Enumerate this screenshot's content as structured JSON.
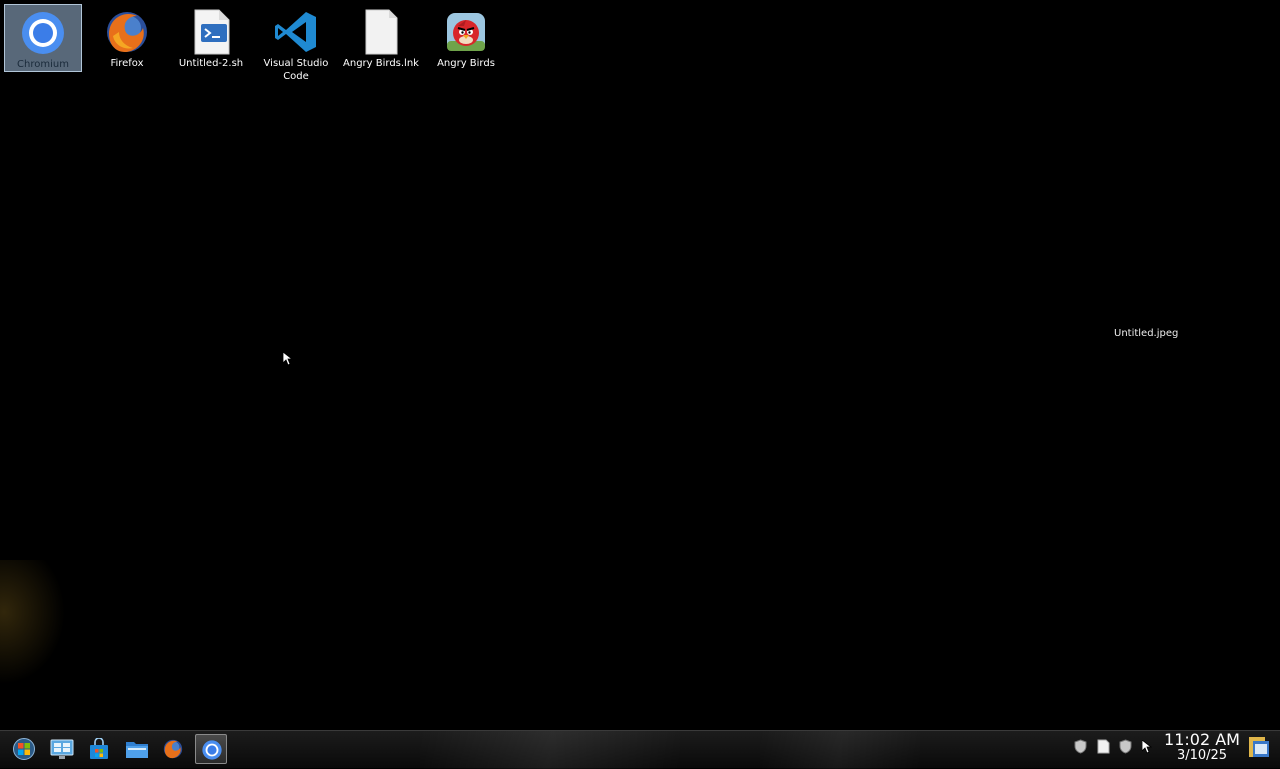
{
  "desktop": {
    "icons": [
      {
        "label": "Chromium",
        "icon": "chromium-icon"
      },
      {
        "label": "Firefox",
        "icon": "firefox-icon"
      },
      {
        "label": "Untitled-2.sh",
        "icon": "script-file-icon"
      },
      {
        "label": "Visual Studio Code",
        "icon": "vscode-icon"
      },
      {
        "label": "Angry Birds.lnk",
        "icon": "blank-file-icon"
      },
      {
        "label": "Angry Birds",
        "icon": "angry-birds-icon"
      }
    ],
    "floating_label": "Untitled.jpeg"
  },
  "taskbar": {
    "buttons": [
      {
        "name": "start-button",
        "icon": "start-orb-icon"
      },
      {
        "name": "control-panel-button",
        "icon": "control-panel-icon"
      },
      {
        "name": "store-button",
        "icon": "store-bag-icon"
      },
      {
        "name": "file-explorer-button",
        "icon": "folder-icon"
      },
      {
        "name": "firefox-taskbar-button",
        "icon": "firefox-icon"
      },
      {
        "name": "chromium-taskbar-button",
        "icon": "chromium-icon",
        "active": true
      }
    ],
    "clock": {
      "time": "11:02 AM",
      "date": "3/10/25"
    }
  },
  "colors": {
    "desktop_bg": "#000000",
    "selection": "#a0bedc",
    "vscode_blue": "#1f8ad2",
    "chromium_blue": "#4285f4"
  }
}
